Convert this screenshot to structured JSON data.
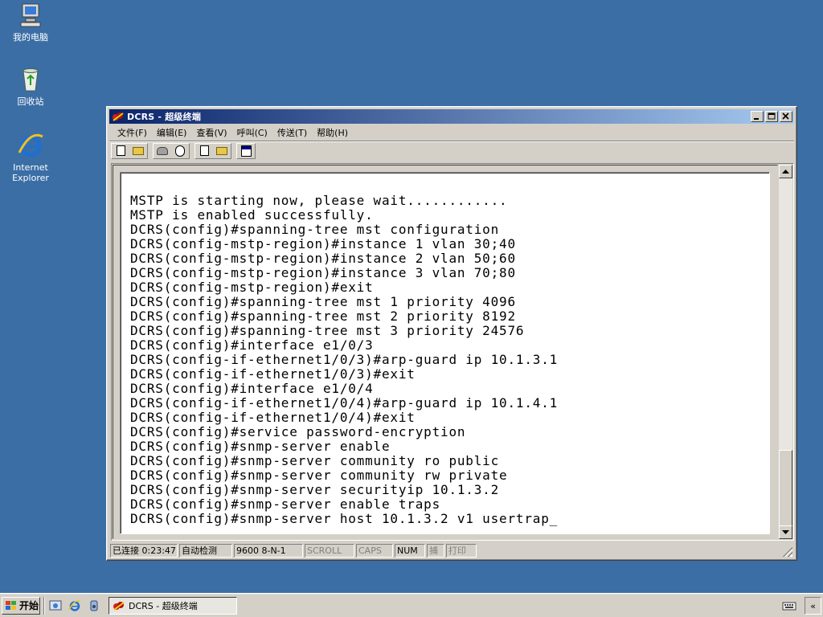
{
  "desktop": {
    "icons": [
      {
        "label": "我的电脑",
        "icon": "my-computer-icon"
      },
      {
        "label": "回收站",
        "icon": "recycle-bin-icon"
      },
      {
        "label": "Internet\nExplorer",
        "icon": "internet-explorer-icon"
      }
    ]
  },
  "window": {
    "title": "DCRS - 超级终端",
    "controls": {
      "minimize": "_",
      "maximize": "□",
      "close": "×"
    },
    "menu": [
      "文件(F)",
      "编辑(E)",
      "查看(V)",
      "呼叫(C)",
      "传送(T)",
      "帮助(H)"
    ],
    "toolbar": [
      {
        "name": "new-connection",
        "icon": "new-document-icon"
      },
      {
        "name": "open",
        "icon": "open-folder-icon"
      },
      {
        "name": "call",
        "icon": "phone-icon"
      },
      {
        "name": "disconnect",
        "icon": "hang-up-icon"
      },
      {
        "name": "send",
        "icon": "send-file-icon"
      },
      {
        "name": "receive",
        "icon": "receive-file-icon"
      },
      {
        "name": "properties",
        "icon": "properties-icon"
      }
    ],
    "terminal": {
      "lines": [
        "MSTP is starting now, please wait............",
        "MSTP is enabled successfully.",
        "DCRS(config)#spanning-tree mst configuration",
        "DCRS(config-mstp-region)#instance 1 vlan 30;40",
        "DCRS(config-mstp-region)#instance 2 vlan 50;60",
        "DCRS(config-mstp-region)#instance 3 vlan 70;80",
        "DCRS(config-mstp-region)#exit",
        "DCRS(config)#spanning-tree mst 1 priority 4096",
        "DCRS(config)#spanning-tree mst 2 priority 8192",
        "DCRS(config)#spanning-tree mst 3 priority 24576",
        "DCRS(config)#interface e1/0/3",
        "DCRS(config-if-ethernet1/0/3)#arp-guard ip 10.1.3.1",
        "DCRS(config-if-ethernet1/0/3)#exit",
        "DCRS(config)#interface e1/0/4",
        "DCRS(config-if-ethernet1/0/4)#arp-guard ip 10.1.4.1",
        "DCRS(config-if-ethernet1/0/4)#exit",
        "DCRS(config)#service password-encryption",
        "DCRS(config)#snmp-server enable",
        "DCRS(config)#snmp-server community ro public",
        "DCRS(config)#snmp-server community rw private",
        "DCRS(config)#snmp-server securityip 10.1.3.2",
        "DCRS(config)#snmp-server enable traps",
        "DCRS(config)#snmp-server host 10.1.3.2 v1 usertrap_"
      ]
    },
    "status": {
      "connected": "已连接 0:23:47",
      "detect": "自动检测",
      "params": "9600 8-N-1",
      "scroll": "SCROLL",
      "caps": "CAPS",
      "num": "NUM",
      "capture": "捕",
      "print": "打印"
    }
  },
  "taskbar": {
    "start_label": "开始",
    "task_label": "DCRS - 超级终端",
    "tray_expand": "«"
  }
}
